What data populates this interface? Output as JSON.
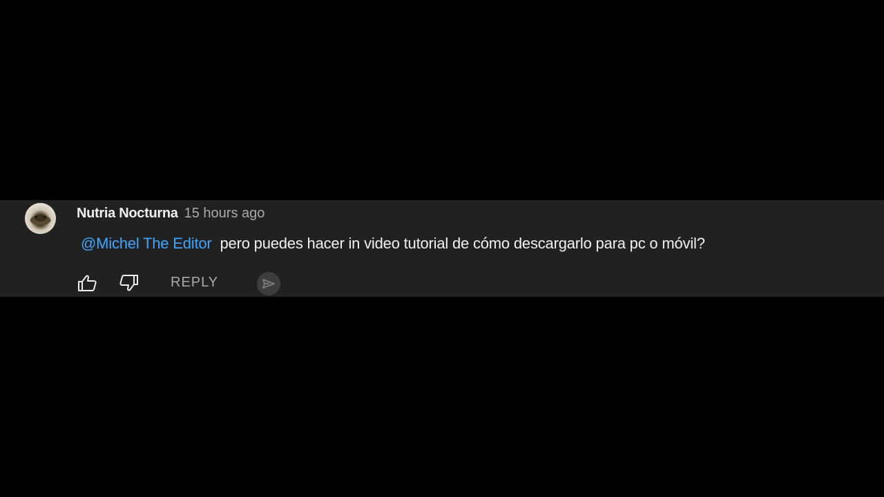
{
  "comment": {
    "author": "Nutria Nocturna",
    "timestamp": "15 hours ago",
    "mention": "@Michel The Editor",
    "text": "pero puedes hacer in video tutorial de cómo descargarlo para pc o móvil?",
    "avatar_icon": "avatar-image"
  },
  "actions": {
    "like_icon": "thumbs-up-icon",
    "dislike_icon": "thumbs-down-icon",
    "reply_label": "REPLY",
    "send_icon": "send-arrow-icon"
  },
  "colors": {
    "page_background": "#000000",
    "card_background": "#212121",
    "mention_color": "#3ea6ff",
    "primary_text": "#f1f1f1",
    "secondary_text": "#aaaaaa"
  }
}
